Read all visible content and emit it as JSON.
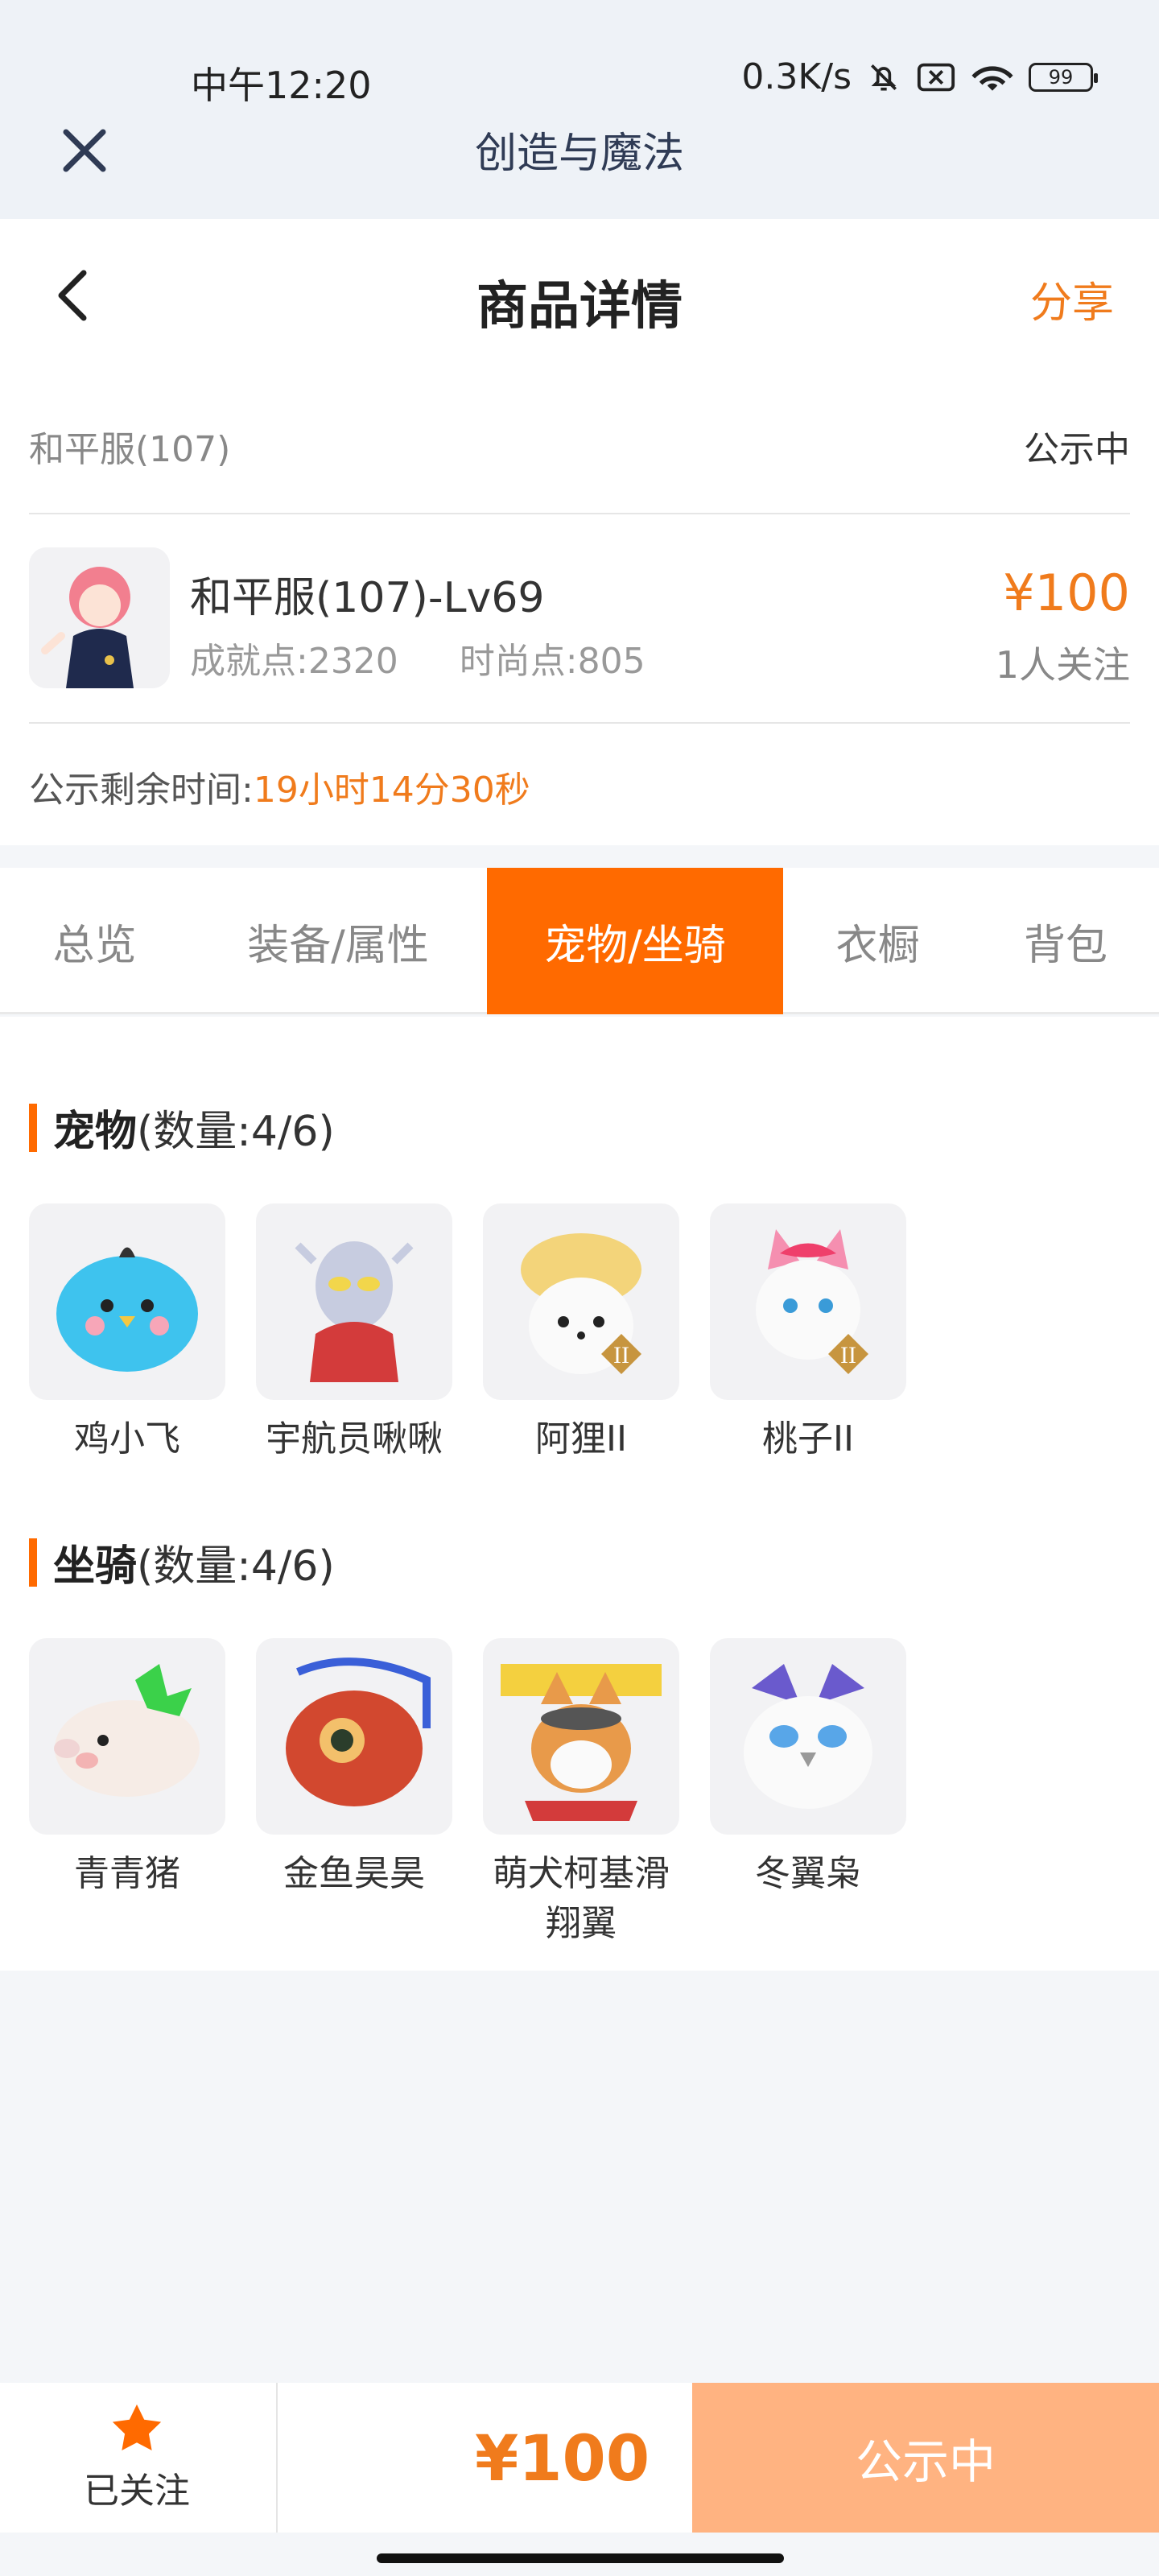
{
  "status_bar": {
    "time": "中午12:20",
    "network_speed": "0.3K/s",
    "battery": "99",
    "icons": [
      "bell-off-icon",
      "close-box-icon",
      "wifi-icon",
      "battery-icon"
    ]
  },
  "app_bar": {
    "title": "创造与魔法",
    "close_icon": "close-icon"
  },
  "header": {
    "title": "商品详情",
    "share": "分享",
    "back_icon": "chevron-left-icon"
  },
  "listing": {
    "server": "和平服(107)",
    "status": "公示中",
    "character_name": "和平服(107)-Lv69",
    "achievement": "成就点:2320",
    "fashion": "时尚点:805",
    "price": "¥100",
    "followers": "1人关注",
    "countdown_label": "公示剩余时间:",
    "countdown_value": "19小时14分30秒"
  },
  "tabs": [
    {
      "label": "总览",
      "active": false
    },
    {
      "label": "装备/属性",
      "active": false
    },
    {
      "label": "宠物/坐骑",
      "active": true
    },
    {
      "label": "衣橱",
      "active": false
    },
    {
      "label": "背包",
      "active": false
    }
  ],
  "pets": {
    "title": "宠物",
    "count": "(数量:4/6)",
    "items": [
      "鸡小飞",
      "宇航员啾啾",
      "阿狸II",
      "桃子II"
    ]
  },
  "mounts": {
    "title": "坐骑",
    "count": "(数量:4/6)",
    "items": [
      "青青猪",
      "金鱼昊昊",
      "萌犬柯基滑翔翼",
      "冬翼枭"
    ]
  },
  "bottom_bar": {
    "follow_label": "已关注",
    "price": "¥100",
    "action": "公示中"
  },
  "colors": {
    "accent": "#ff6a00",
    "price": "#f07b1c",
    "action_button": "#ffb381"
  }
}
